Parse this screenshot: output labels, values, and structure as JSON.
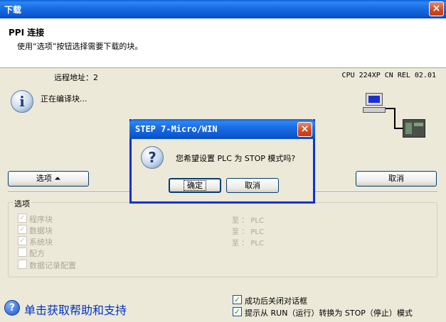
{
  "window": {
    "title": "下载",
    "close": "×"
  },
  "header": {
    "title": "PPI 连接",
    "description": "使用“选项”按钮选择需要下载的块。"
  },
  "remote_address": "远程地址：2",
  "cpu_info": "CPU 224XP CN REL 02.01",
  "status": {
    "info_glyph": "i",
    "text": "正在编译块..."
  },
  "buttons": {
    "options": "选项 ⏶",
    "cancel": "取消"
  },
  "options_group": {
    "title": "选项",
    "items": [
      {
        "label": "程序块",
        "check": "✓",
        "target": "至 ： PLC"
      },
      {
        "label": "数据块",
        "check": "✓",
        "target": "至 ： PLC"
      },
      {
        "label": "系统块",
        "check": "✓",
        "target": "至 ： PLC"
      },
      {
        "label": "配方",
        "check": "",
        "target": ""
      },
      {
        "label": "数据记录配置",
        "check": "",
        "target": ""
      }
    ]
  },
  "help": {
    "glyph": "?",
    "text": "单击获取帮助和支持"
  },
  "checkboxes": [
    {
      "label": "成功后关闭对话框",
      "check": "✓"
    },
    {
      "label": "提示从 RUN（运行）转换为 STOP（停止）模式",
      "check": "✓"
    }
  ],
  "modal": {
    "title": "STEP 7-Micro/WIN",
    "close": "×",
    "glyph": "?",
    "message": "您希望设置 PLC 为 STOP 模式吗?",
    "ok": "确定",
    "cancel": "取消"
  }
}
